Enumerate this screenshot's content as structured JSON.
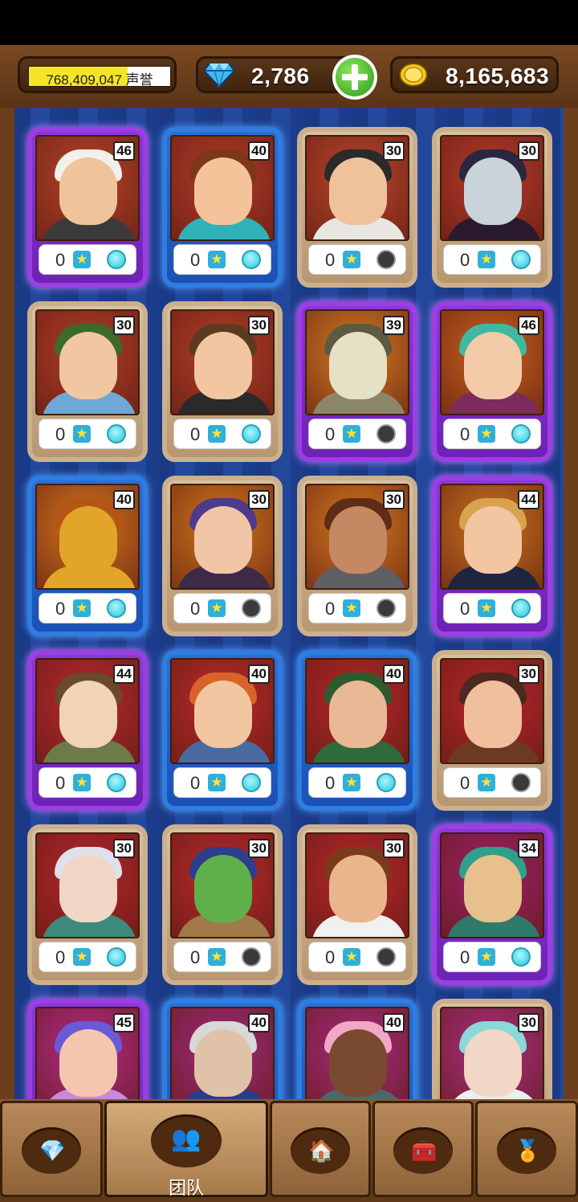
{
  "header": {
    "fame": {
      "value_text": "768,409,047",
      "label": "声誉",
      "fill_fraction": 0.7
    },
    "gems": {
      "icon": "diamond-icon",
      "value": "2,786"
    },
    "add_button": {
      "icon": "plus-icon"
    },
    "gold": {
      "icon": "gold-coin-icon",
      "value": "8,165,683"
    }
  },
  "heroes": [
    {
      "level": "46",
      "stars": "0",
      "active": true,
      "rarity": "purple",
      "bg": "#b5432a",
      "skin": "#f0c49a",
      "hair": "#f2f0ea",
      "cloth": "#3b3b3b"
    },
    {
      "level": "40",
      "stars": "0",
      "active": true,
      "rarity": "blue",
      "bg": "#b23a28",
      "skin": "#f4c39a",
      "hair": "#7b3716",
      "cloth": "#2fb3b8"
    },
    {
      "level": "30",
      "stars": "0",
      "active": false,
      "rarity": "common",
      "bg": "#b8452c",
      "skin": "#f0c29c",
      "hair": "#2a2a2a",
      "cloth": "#e8e6e0"
    },
    {
      "level": "30",
      "stars": "0",
      "active": true,
      "rarity": "common",
      "bg": "#b53a2a",
      "skin": "#c8d4da",
      "hair": "#2b2740",
      "cloth": "#2a1a30"
    },
    {
      "level": "30",
      "stars": "0",
      "active": true,
      "rarity": "common",
      "bg": "#b03c28",
      "skin": "#f0c7a0",
      "hair": "#3b6a2c",
      "cloth": "#6fa8d6"
    },
    {
      "level": "30",
      "stars": "0",
      "active": true,
      "rarity": "common",
      "bg": "#b43c2a",
      "skin": "#f2c6a0",
      "hair": "#5c3a20",
      "cloth": "#2a2a2a"
    },
    {
      "level": "39",
      "stars": "0",
      "active": false,
      "rarity": "purple",
      "bg": "#d37a22",
      "skin": "#e6e1c6",
      "hair": "#5d5a44",
      "cloth": "#8c8668"
    },
    {
      "level": "46",
      "stars": "0",
      "active": true,
      "rarity": "purple",
      "bg": "#c8621e",
      "skin": "#f4cba8",
      "hair": "#3fb9a2",
      "cloth": "#7c2b5c"
    },
    {
      "level": "40",
      "stars": "0",
      "active": true,
      "rarity": "blue",
      "bg": "#d3741e",
      "skin": "#e2a52a",
      "hair": "#b55616",
      "cloth": "#e2a52a"
    },
    {
      "level": "30",
      "stars": "0",
      "active": false,
      "rarity": "common",
      "bg": "#d2761c",
      "skin": "#f1c6a6",
      "hair": "#4f3a8e",
      "cloth": "#3c2a48"
    },
    {
      "level": "30",
      "stars": "0",
      "active": false,
      "rarity": "common",
      "bg": "#d5781e",
      "skin": "#c48862",
      "hair": "#5c2e18",
      "cloth": "#5f6066"
    },
    {
      "level": "44",
      "stars": "0",
      "active": true,
      "rarity": "purple",
      "bg": "#c9731f",
      "skin": "#f2c6a0",
      "hair": "#d9a24e",
      "cloth": "#1f2440"
    },
    {
      "level": "44",
      "stars": "0",
      "active": true,
      "rarity": "purple",
      "bg": "#b72830",
      "skin": "#f1d3b6",
      "hair": "#6a4a2a",
      "cloth": "#6d7a4a"
    },
    {
      "level": "40",
      "stars": "0",
      "active": true,
      "rarity": "blue",
      "bg": "#b92a2a",
      "skin": "#f1c6a0",
      "hair": "#d9632a",
      "cloth": "#4a6aa0"
    },
    {
      "level": "40",
      "stars": "0",
      "active": true,
      "rarity": "blue",
      "bg": "#b5262a",
      "skin": "#e9b894",
      "hair": "#2f5a2e",
      "cloth": "#2f6a3a"
    },
    {
      "level": "30",
      "stars": "0",
      "active": false,
      "rarity": "common",
      "bg": "#b8262c",
      "skin": "#f0c09e",
      "hair": "#4a2a1e",
      "cloth": "#6c3a22"
    },
    {
      "level": "30",
      "stars": "0",
      "active": true,
      "rarity": "common",
      "bg": "#b6262c",
      "skin": "#f1d6c6",
      "hair": "#e0e0ec",
      "cloth": "#3b8a7a"
    },
    {
      "level": "30",
      "stars": "0",
      "active": false,
      "rarity": "common",
      "bg": "#b8292c",
      "skin": "#5fb04a",
      "hair": "#2e3e8a",
      "cloth": "#a07a4a"
    },
    {
      "level": "30",
      "stars": "0",
      "active": false,
      "rarity": "common",
      "bg": "#b9262c",
      "skin": "#e9b58c",
      "hair": "#7a3a1c",
      "cloth": "#f0f0f0"
    },
    {
      "level": "34",
      "stars": "0",
      "active": true,
      "rarity": "purple",
      "bg": "#a0206a",
      "skin": "#e8c08e",
      "hair": "#2fa08a",
      "cloth": "#2f7a6a"
    },
    {
      "level": "45",
      "stars": "0",
      "active": true,
      "rarity": "purple",
      "bg": "#b52a8a",
      "skin": "#f4c6b0",
      "hair": "#6a5ad8",
      "cloth": "#c88ad8"
    },
    {
      "level": "40",
      "stars": "0",
      "active": true,
      "rarity": "blue",
      "bg": "#a12a7a",
      "skin": "#e0c2a8",
      "hair": "#d8d8d8",
      "cloth": "#2a3c8a"
    },
    {
      "level": "40",
      "stars": "0",
      "active": true,
      "rarity": "blue",
      "bg": "#a72a7e",
      "skin": "#7a4a30",
      "hair": "#f1a8c6",
      "cloth": "#4a6a6a"
    },
    {
      "level": "30",
      "stars": "0",
      "active": true,
      "rarity": "common",
      "bg": "#ab2e82",
      "skin": "#f2d6c6",
      "hair": "#8ad8d8",
      "cloth": "#e8f0f0"
    }
  ],
  "nav": [
    {
      "name": "nav-shop",
      "icon": "diamond-icon",
      "glyph": "💎",
      "label": ""
    },
    {
      "name": "nav-team",
      "icon": "team-icon",
      "glyph": "👥",
      "label": "团队"
    },
    {
      "name": "nav-town",
      "icon": "buildings-icon",
      "glyph": "🏠",
      "label": ""
    },
    {
      "name": "nav-chest",
      "icon": "treasure-chest-icon",
      "glyph": "🧰",
      "label": ""
    },
    {
      "name": "nav-achievements",
      "icon": "medal-icon",
      "glyph": "🏅",
      "label": ""
    }
  ]
}
